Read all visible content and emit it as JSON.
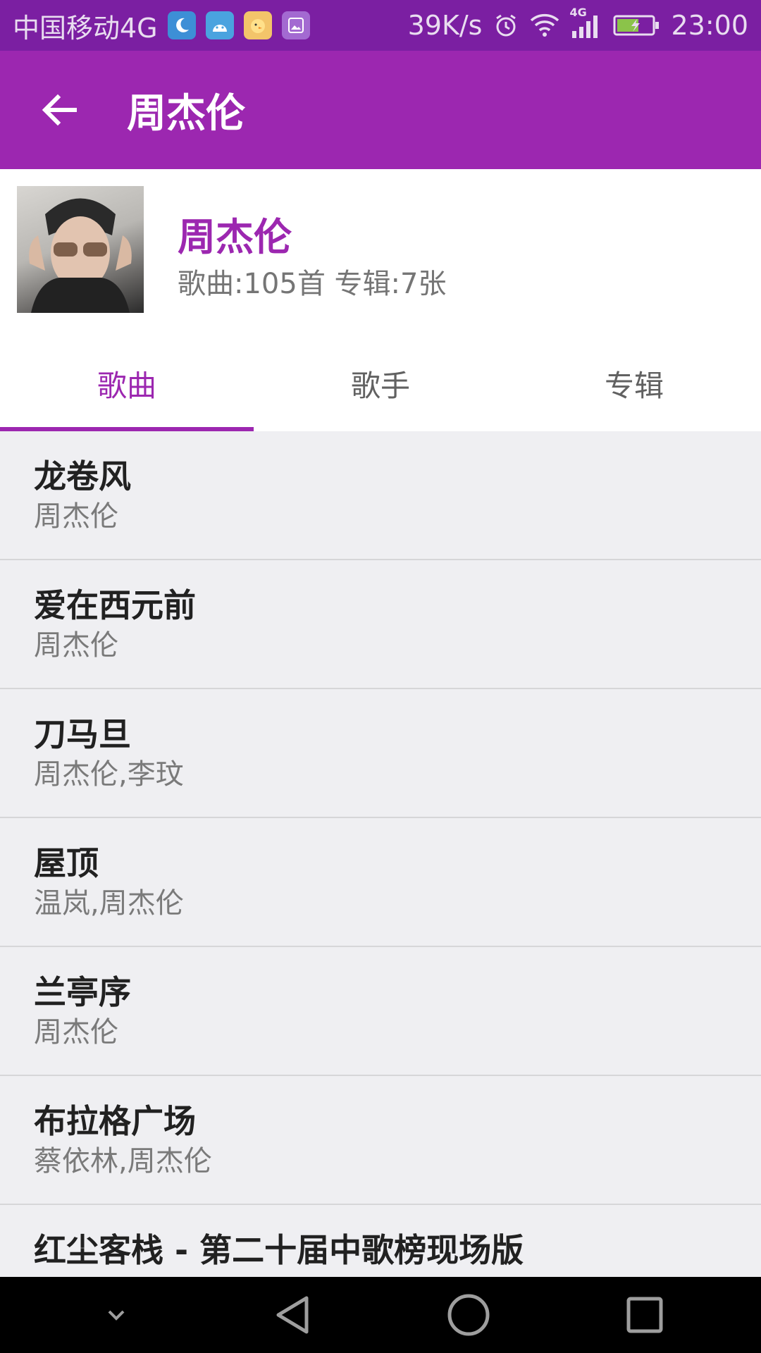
{
  "status_bar": {
    "carrier": "中国移动4G",
    "net_speed": "39K/s",
    "network_label": "4G",
    "time": "23:00",
    "notification_icons": [
      "moon-icon",
      "android-icon",
      "chick-app-icon",
      "gallery-icon"
    ]
  },
  "app_bar": {
    "title": "周杰伦"
  },
  "artist": {
    "name": "周杰伦",
    "stats": "歌曲:105首 专辑:7张"
  },
  "tabs": [
    {
      "label": "歌曲",
      "active": true
    },
    {
      "label": "歌手",
      "active": false
    },
    {
      "label": "专辑",
      "active": false
    }
  ],
  "songs": [
    {
      "title": "龙卷风",
      "artist": "周杰伦"
    },
    {
      "title": "爱在西元前",
      "artist": "周杰伦"
    },
    {
      "title": "刀马旦",
      "artist": "周杰伦,李玟"
    },
    {
      "title": "屋顶",
      "artist": "温岚,周杰伦"
    },
    {
      "title": "兰亭序",
      "artist": "周杰伦"
    },
    {
      "title": "布拉格广场",
      "artist": "蔡依林,周杰伦"
    },
    {
      "title": "红尘客栈 - 第二十届中歌榜现场版",
      "artist": ""
    }
  ],
  "colors": {
    "primary": "#9c27b0",
    "primary_dark": "#7b1fa2",
    "list_bg": "#efeff2"
  }
}
